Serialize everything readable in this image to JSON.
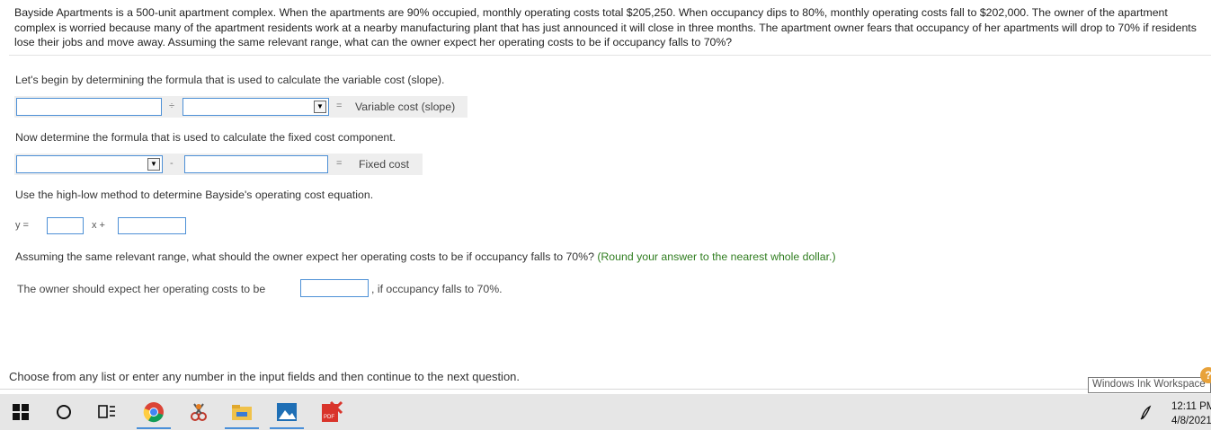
{
  "problem": {
    "text": "Bayside Apartments is a 500-unit apartment complex. When the apartments are 90% occupied, monthly operating costs total $205,250. When occupancy dips to 80%, monthly operating costs fall to $202,000. The owner of the apartment complex is worried because many of the apartment residents work at a nearby manufacturing plant that has just announced it will close in three months. The apartment owner fears that occupancy of her apartments will drop to 70% if residents lose their jobs and move away. Assuming the same relevant range, what can the owner expect her operating costs to be if occupancy falls to 70%?"
  },
  "step1": {
    "instruction": "Let's begin by determining the formula that is used to calculate the variable cost (slope).",
    "operator": "÷",
    "equals": "=",
    "result_label": "Variable cost (slope)",
    "input1_value": "",
    "select_value": ""
  },
  "step2": {
    "instruction": "Now determine the formula that is used to calculate the fixed cost component.",
    "operator": "-",
    "equals": "=",
    "result_label": "Fixed cost",
    "select_value": "",
    "input_value": ""
  },
  "step3": {
    "instruction": "Use the high-low method to determine Bayside's operating cost equation.",
    "y_label": "y =",
    "x_label": "x +",
    "slope_value": "",
    "intercept_value": ""
  },
  "step4": {
    "question": "Assuming the same relevant range, what should the owner expect her operating costs to be if occupancy falls to 70%?",
    "hint": "(Round your answer to the nearest whole dollar.)",
    "answer_prefix": "The owner should expect her operating costs to be",
    "answer_suffix": ", if occupancy falls to 70%.",
    "answer_value": ""
  },
  "footer": {
    "instruction": "Choose from any list or enter any number in the input fields and then continue to the next question."
  },
  "ink_workspace": {
    "label": "Windows Ink Workspace",
    "help": "?"
  },
  "taskbar": {
    "icons": [
      "windows-start-icon",
      "cortana-search-icon",
      "task-view-icon",
      "chrome-icon",
      "snipping-tool-icon",
      "file-explorer-icon",
      "photos-icon",
      "pdf-reader-icon"
    ],
    "pdf_label": "PDF",
    "time": "12:11 PM",
    "date": "4/8/2021",
    "accent": "#4a90d9"
  }
}
